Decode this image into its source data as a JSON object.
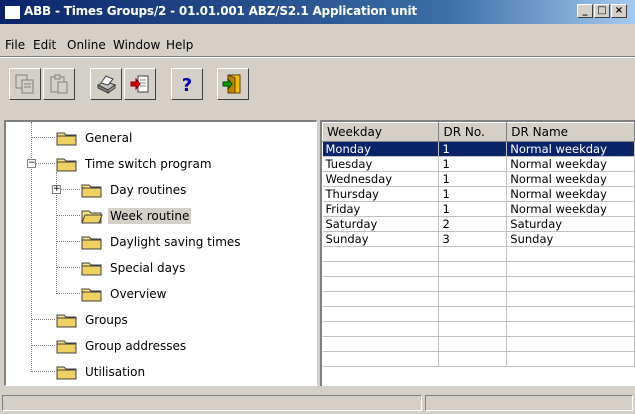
{
  "window": {
    "title": "ABB - Times Groups/2 - 01.01.001 ABZ/S2.1 Application unit",
    "minimize": "_",
    "maximize": "□",
    "close": "×"
  },
  "menu": [
    {
      "label": "File"
    },
    {
      "label": "Edit"
    },
    {
      "label": "Online"
    },
    {
      "label": "Window"
    },
    {
      "label": "Help"
    }
  ],
  "toolbar": {
    "buttons": [
      {
        "icon": "copy-icon",
        "enabled": false
      },
      {
        "icon": "paste-icon",
        "enabled": false
      },
      {
        "icon": "print-icon",
        "enabled": true
      },
      {
        "icon": "import-icon",
        "enabled": true
      },
      {
        "icon": "help-icon",
        "enabled": true
      },
      {
        "icon": "exit-icon",
        "enabled": true
      }
    ]
  },
  "tree": {
    "items": [
      {
        "label": "General"
      },
      {
        "label": "Time switch program",
        "expanded": true
      },
      {
        "label": "Day routines",
        "collapsed": true
      },
      {
        "label": "Week routine",
        "selected": true
      },
      {
        "label": "Daylight saving times"
      },
      {
        "label": "Special days"
      },
      {
        "label": "Overview"
      },
      {
        "label": "Groups"
      },
      {
        "label": "Group addresses"
      },
      {
        "label": "Utilisation"
      }
    ]
  },
  "table": {
    "columns": [
      "Weekday",
      "DR No.",
      "DR Name"
    ],
    "rows": [
      [
        "Monday",
        "1",
        "Normal weekday"
      ],
      [
        "Tuesday",
        "1",
        "Normal weekday"
      ],
      [
        "Wednesday",
        "1",
        "Normal weekday"
      ],
      [
        "Thursday",
        "1",
        "Normal weekday"
      ],
      [
        "Friday",
        "1",
        "Normal weekday"
      ],
      [
        "Saturday",
        "2",
        "Saturday"
      ],
      [
        "Sunday",
        "3",
        "Sunday"
      ]
    ],
    "selected_row": 0
  },
  "colors": {
    "titlebar_start": "#0a246a",
    "selection": "#0a246a",
    "face": "#d4d0c8"
  }
}
